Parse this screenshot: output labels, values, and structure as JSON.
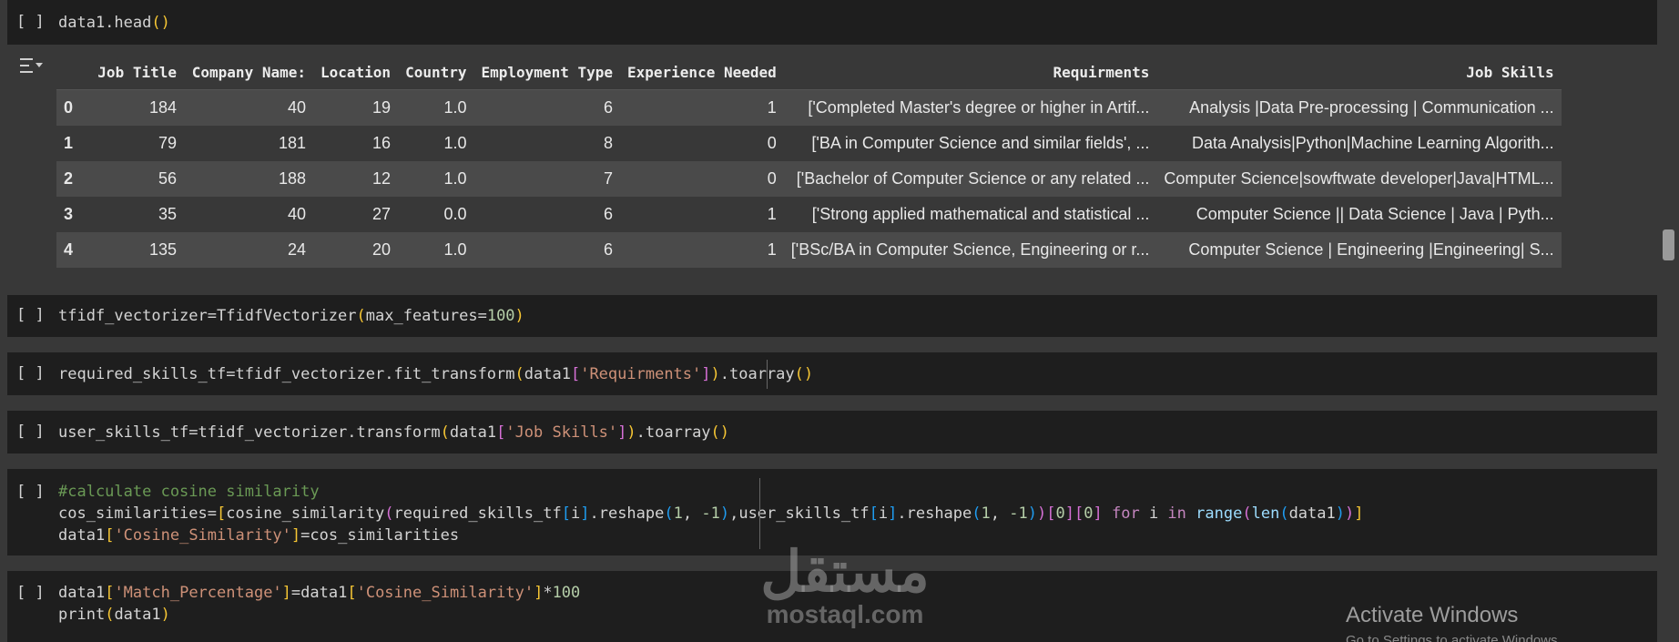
{
  "run_label": "[ ]",
  "cells": {
    "head": {
      "code_fn": "data1.head",
      "code_parens": "()"
    },
    "tfidf": {
      "a": "tfidf_vectorizer=TfidfVectorizer",
      "b": "(",
      "c": "max_features=",
      "d": "100",
      "e": ")"
    },
    "req": {
      "a": "required_skills_tf=tfidf_vectorizer.fit_transform",
      "b": "(",
      "c": "data1",
      "d": "[",
      "e": "'Requirments'",
      "f": "]",
      "g": ")",
      "h": ".toarray",
      "i": "()"
    },
    "user": {
      "a": "user_skills_tf=tfidf_vectorizer.transform",
      "b": "(",
      "c": "data1",
      "d": "[",
      "e": "'Job Skills'",
      "f": "]",
      "g": ")",
      "h": ".toarray",
      "i": "()"
    },
    "cos": {
      "comment": "#calculate cosine similarity",
      "l2": [
        "cos_similarities=",
        "[",
        "cosine_similarity",
        "(",
        "required_skills_tf",
        "[",
        "i",
        "]",
        ".reshape",
        "(",
        "1",
        ", ",
        "-1",
        ")",
        ",user_skills_tf",
        "[",
        "i",
        "]",
        ".reshape",
        "(",
        "1",
        ", ",
        "-1",
        ")",
        ")",
        "[",
        "0",
        "]",
        "[",
        "0",
        "]",
        " ",
        "for",
        " i ",
        "in",
        " ",
        "range",
        "(",
        "len",
        "(",
        "data1",
        ")",
        ")",
        "]"
      ],
      "l3": [
        "data1",
        "[",
        "'Cosine_Similarity'",
        "]",
        "=cos_similarities"
      ]
    },
    "match": {
      "l1": [
        "data1",
        "[",
        "'Match_Percentage'",
        "]",
        "=data1",
        "[",
        "'Cosine_Similarity'",
        "]",
        "*",
        "100"
      ],
      "l2": [
        "print",
        "(",
        "data1",
        ")"
      ]
    }
  },
  "table": {
    "columns": [
      "",
      "Job Title",
      "Company Name:",
      "Location",
      "Country",
      "Employment Type",
      "Experience Needed",
      "Requirments",
      "Job Skills"
    ],
    "rows": [
      [
        "0",
        "184",
        "40",
        "19",
        "1.0",
        "6",
        "1",
        "['Completed Master's degree or higher in Artif...",
        "Analysis |Data Pre-processing | Communication ..."
      ],
      [
        "1",
        "79",
        "181",
        "16",
        "1.0",
        "8",
        "0",
        "['BA in Computer Science and similar fields', ...",
        "Data Analysis|Python|Machine Learning Algorith..."
      ],
      [
        "2",
        "56",
        "188",
        "12",
        "1.0",
        "7",
        "0",
        "['Bachelor of Computer Science or any related ...",
        "Computer Science|sowftwate developer|Java|HTML..."
      ],
      [
        "3",
        "35",
        "40",
        "27",
        "0.0",
        "6",
        "1",
        "['Strong applied mathematical and statistical ...",
        "Computer Science || Data Science | Java | Pyth..."
      ],
      [
        "4",
        "135",
        "24",
        "20",
        "1.0",
        "6",
        "1",
        "['BSc/BA in Computer Science, Engineering or r...",
        "Computer Science | Engineering |Engineering| S..."
      ]
    ]
  },
  "watermark": {
    "arabic": "مستقل",
    "latin": "mostaql.com"
  },
  "windows_notice": {
    "title": "Activate Windows",
    "sub": "Go to Settings to activate Windows."
  },
  "colors": {
    "string": "#ce9178",
    "number": "#b5cea8",
    "comment": "#6a9955",
    "keyword": "#c586c0",
    "bracket1": "#f6c634",
    "bracket2": "#d670d6",
    "bracket3": "#1f9cf0"
  }
}
